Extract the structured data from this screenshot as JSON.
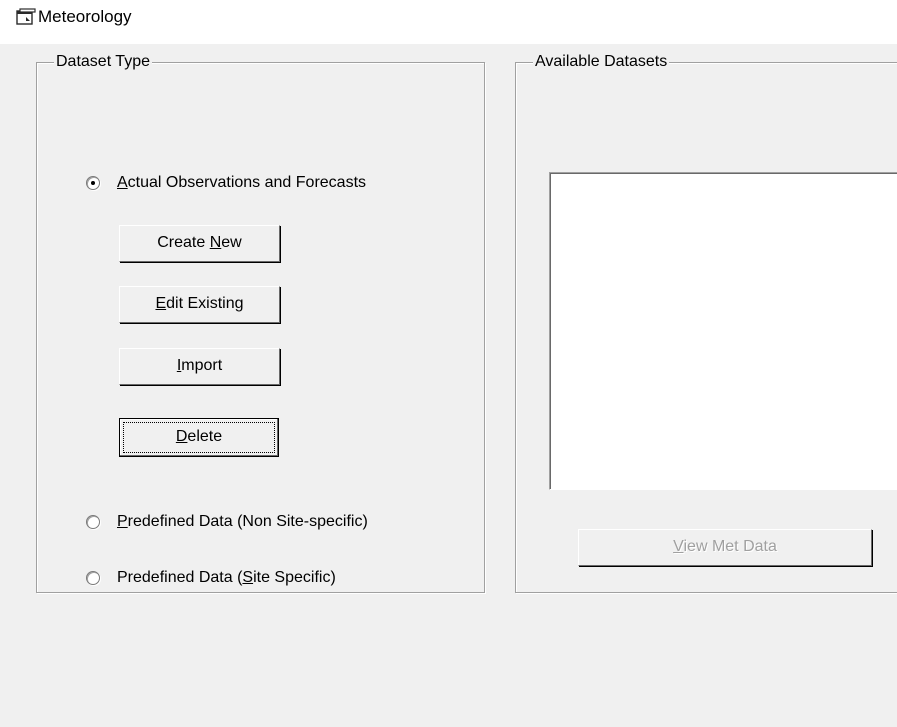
{
  "window": {
    "title": "Meteorology",
    "icon": "window-icon"
  },
  "dataset_type": {
    "legend": "Dataset Type",
    "options": [
      {
        "label_pre": "",
        "mnemonic": "A",
        "label_post": "ctual Observations and Forecasts",
        "selected": true
      },
      {
        "label_pre": "",
        "mnemonic": "P",
        "label_post": "redefined Data (Non Site-specific)",
        "selected": false
      },
      {
        "label_pre": "Predefined Data (",
        "mnemonic": "S",
        "label_post": "ite Specific)",
        "selected": false
      }
    ],
    "buttons": {
      "create_new": {
        "pre": "Create ",
        "mnemonic": "N",
        "post": "ew"
      },
      "edit_existing": {
        "pre": "",
        "mnemonic": "E",
        "post": "dit Existing"
      },
      "import": {
        "pre": "",
        "mnemonic": "I",
        "post": "mport"
      },
      "delete": {
        "pre": "",
        "mnemonic": "D",
        "post": "elete"
      }
    }
  },
  "available_datasets": {
    "legend": "Available Datasets",
    "items": [],
    "view_button": {
      "pre": "",
      "mnemonic": "V",
      "post": "iew Met Data",
      "enabled": false
    }
  }
}
